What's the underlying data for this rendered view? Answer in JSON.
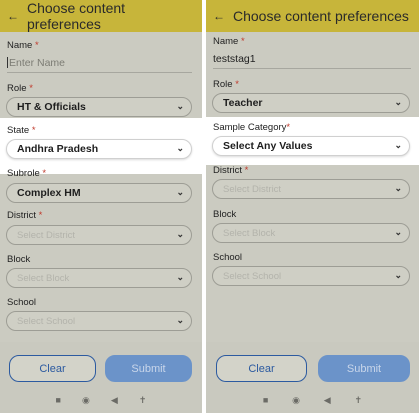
{
  "left": {
    "title": "Choose content preferences",
    "name_label": "Name",
    "name_placeholder": "Enter Name",
    "role_label": "Role",
    "role_value": "HT & Officials",
    "state_label": "State",
    "state_value": "Andhra Pradesh",
    "subrole_label": "Subrole",
    "subrole_value": "Complex HM",
    "district_label": "District",
    "district_placeholder": "Select District",
    "block_label": "Block",
    "block_placeholder": "Select Block",
    "school_label": "School",
    "school_placeholder": "Select School",
    "clear_label": "Clear",
    "submit_label": "Submit"
  },
  "right": {
    "title": "Choose content preferences",
    "name_label": "Name",
    "name_value": "teststag1",
    "role_label": "Role",
    "role_value": "Teacher",
    "sample_label": "Sample Category",
    "sample_value": "Select Any Values",
    "district_label": "District",
    "district_placeholder": "Select District",
    "block_label": "Block",
    "block_placeholder": "Select Block",
    "school_label": "School",
    "school_placeholder": "Select School",
    "clear_label": "Clear",
    "submit_label": "Submit"
  },
  "symbols": {
    "back": "←",
    "required": "*",
    "chevron": "⌄",
    "nav_square": "■",
    "nav_circle": "◉",
    "nav_back": "◀",
    "nav_accessibility": "✝"
  },
  "colors": {
    "header": "#c7b53a",
    "clear_border": "#2c5aa0",
    "submit_bg": "#6b93c9"
  }
}
